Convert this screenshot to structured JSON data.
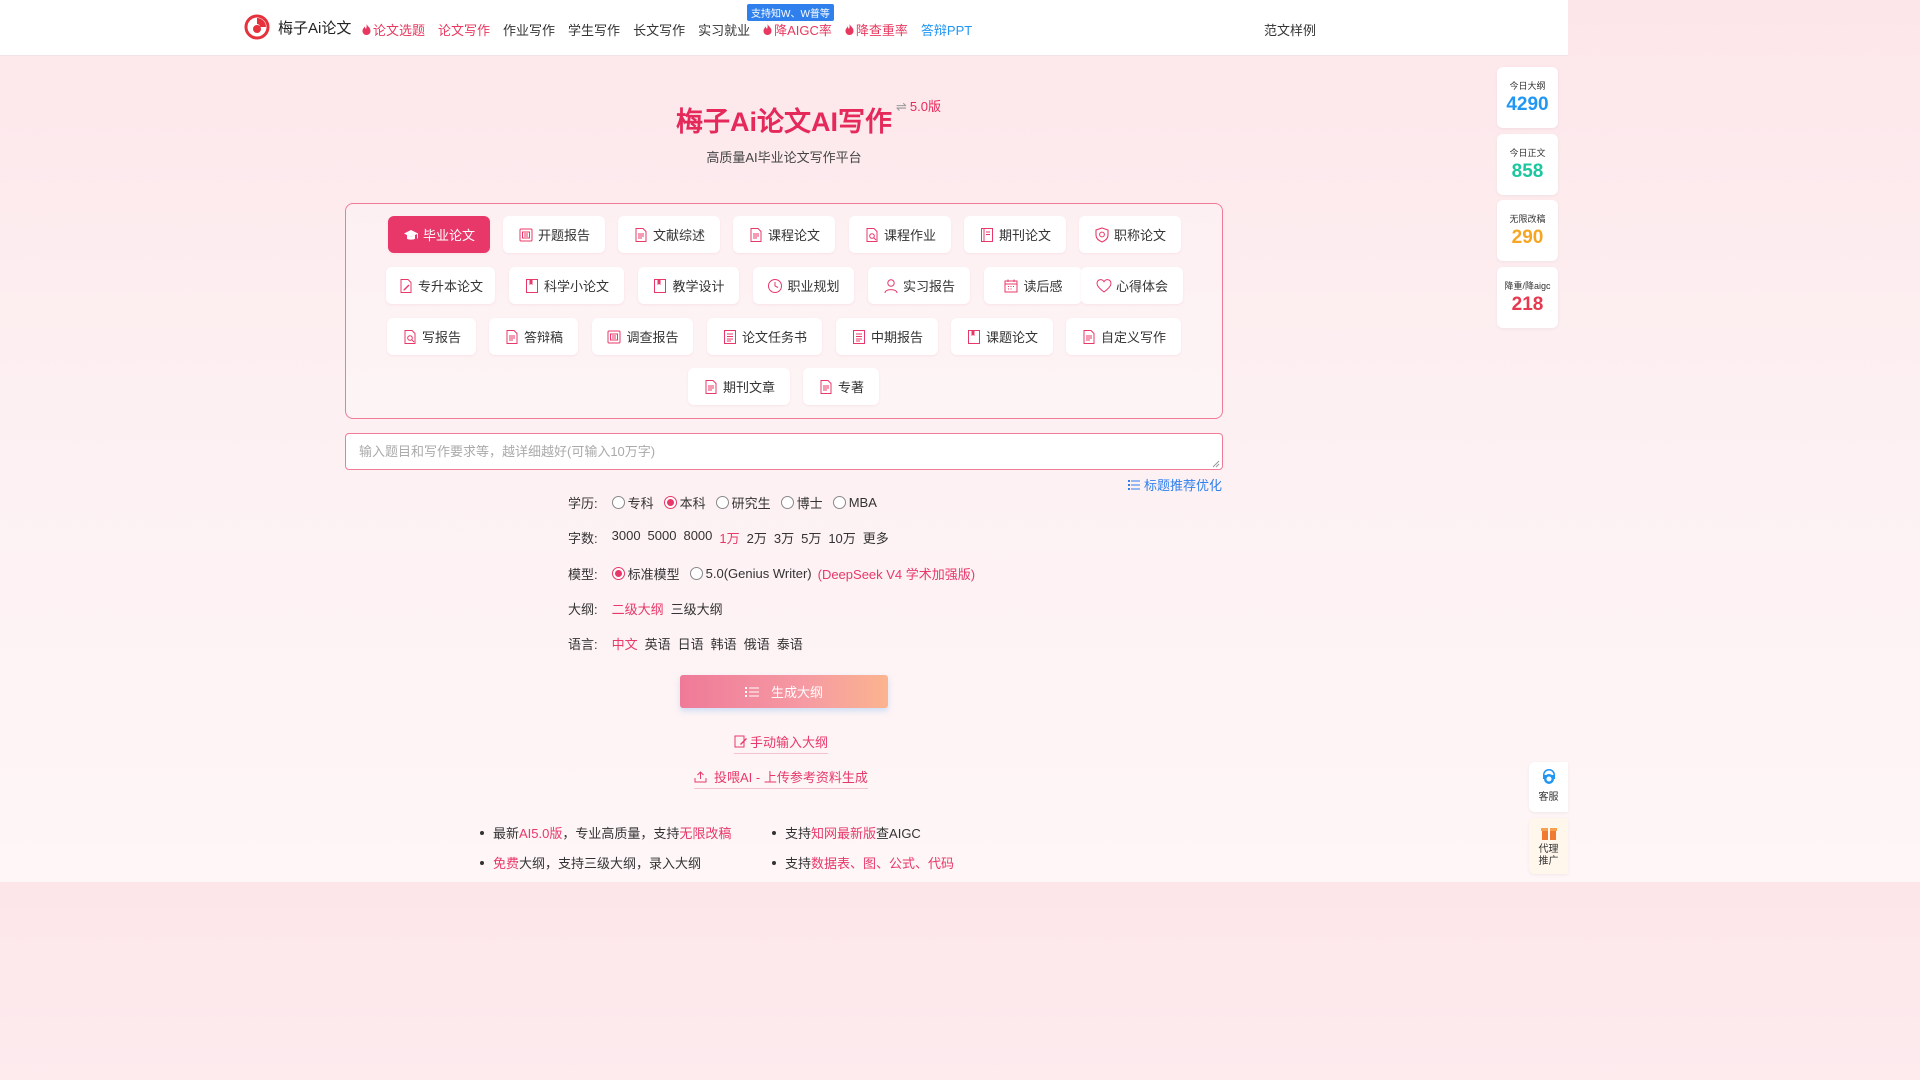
{
  "nav": {
    "brand": "梅子Ai论文",
    "links": [
      {
        "label": "论文选题",
        "hot": true
      },
      {
        "label": "论文写作",
        "accent": true
      },
      {
        "label": "作业写作"
      },
      {
        "label": "学生写作"
      },
      {
        "label": "长文写作"
      },
      {
        "label": "实习就业"
      },
      {
        "label": "降AIGC率",
        "hot": true
      },
      {
        "label": "降查重率",
        "hot": true
      },
      {
        "label": "答辩PPT",
        "blue": true
      }
    ],
    "badge": "支持知W、W普等",
    "right_link": "范文样例",
    "colors": {
      "hot": "#e8385f",
      "blue": "#2196f3"
    }
  },
  "hero": {
    "title": "梅子Ai论文AI写作",
    "version_icon": "⇌",
    "version": "5.0版",
    "subtitle": "高质量AI毕业论文写作平台"
  },
  "categories": [
    {
      "label": "毕业论文",
      "icon": "graduation-cap-icon",
      "active": true
    },
    {
      "label": "开题报告",
      "icon": "report-icon"
    },
    {
      "label": "文献综述",
      "icon": "document-icon"
    },
    {
      "label": "课程论文",
      "icon": "document-icon"
    },
    {
      "label": "课程作业",
      "icon": "document-search-icon"
    },
    {
      "label": "期刊论文",
      "icon": "journal-icon"
    },
    {
      "label": "职称论文",
      "icon": "shield-icon"
    },
    {
      "label": "专升本论文",
      "icon": "document-edit-icon"
    },
    {
      "label": "科学小论文",
      "icon": "bookmark-icon"
    },
    {
      "label": "教学设计",
      "icon": "bookmark-icon"
    },
    {
      "label": "职业规划",
      "icon": "clock-icon"
    },
    {
      "label": "实习报告",
      "icon": "user-icon"
    },
    {
      "label": "读后感",
      "icon": "calendar-icon"
    },
    {
      "label": "心得体会",
      "icon": "heart-icon"
    },
    {
      "label": "写报告",
      "icon": "document-search-icon"
    },
    {
      "label": "答辩稿",
      "icon": "document-icon"
    },
    {
      "label": "调查报告",
      "icon": "report-icon"
    },
    {
      "label": "论文任务书",
      "icon": "list-doc-icon"
    },
    {
      "label": "中期报告",
      "icon": "list-doc-icon"
    },
    {
      "label": "课题论文",
      "icon": "bookmark-icon"
    },
    {
      "label": "自定义写作",
      "icon": "document-icon"
    },
    {
      "label": "期刊文章",
      "icon": "document-icon"
    },
    {
      "label": "专著",
      "icon": "document-icon"
    }
  ],
  "input": {
    "placeholder": "输入题目和写作要求等，越详细越好(可输入10万字)",
    "value": "",
    "recommend_label": "标题推荐优化"
  },
  "options": {
    "education": {
      "label": "学历:",
      "items": [
        "专科",
        "本科",
        "研究生",
        "博士",
        "MBA"
      ],
      "selected": "本科"
    },
    "word_count": {
      "label": "字数:",
      "items": [
        "3000",
        "5000",
        "8000",
        "1万",
        "2万",
        "3万",
        "5万",
        "10万",
        "更多"
      ],
      "selected": "1万"
    },
    "model": {
      "label": "模型:",
      "items": [
        "标准模型",
        "5.0(Genius Writer)"
      ],
      "selected": "标准模型",
      "note": "(DeepSeek V4 学术加强版)"
    },
    "outline": {
      "label": "大纲:",
      "items": [
        "二级大纲",
        "三级大纲"
      ],
      "selected": "二级大纲"
    },
    "language": {
      "label": "语言:",
      "items": [
        "中文",
        "英语",
        "日语",
        "韩语",
        "俄语",
        "泰语"
      ],
      "selected": "中文"
    }
  },
  "actions": {
    "generate": "生成大纲",
    "manual_outline": "手动输入大纲",
    "upload": "投喂AI - 上传参考资料生成"
  },
  "features": [
    {
      "parts": [
        {
          "t": "最新"
        },
        {
          "t": "AI5.0版",
          "hl": true
        },
        {
          "t": "，专业高质量，支持"
        },
        {
          "t": "无限改稿",
          "hl": true
        }
      ]
    },
    {
      "parts": [
        {
          "t": "支持"
        },
        {
          "t": "知网最新版",
          "hl": true
        },
        {
          "t": "查AIGC"
        }
      ]
    },
    {
      "parts": [
        {
          "t": "免费",
          "hl": true
        },
        {
          "t": "大纲，支持三级大纲，录入大纲"
        }
      ]
    },
    {
      "parts": [
        {
          "t": "支持"
        },
        {
          "t": "数据表、图、公式、代码",
          "hl": true
        }
      ]
    }
  ],
  "stats": [
    {
      "label": "今日大纲",
      "value": "4290",
      "color": "#2196f3"
    },
    {
      "label": "今日正文",
      "value": "858",
      "color": "#1cc7a0"
    },
    {
      "label": "无限改稿",
      "value": "290",
      "color": "#f5a623"
    },
    {
      "label": "降重/降aigc",
      "value": "218",
      "color": "#e53950"
    }
  ],
  "side_buttons": [
    {
      "label": "客服",
      "icon": "customer-service-icon"
    },
    {
      "label": "代理推广",
      "icon": "gift-icon"
    }
  ]
}
